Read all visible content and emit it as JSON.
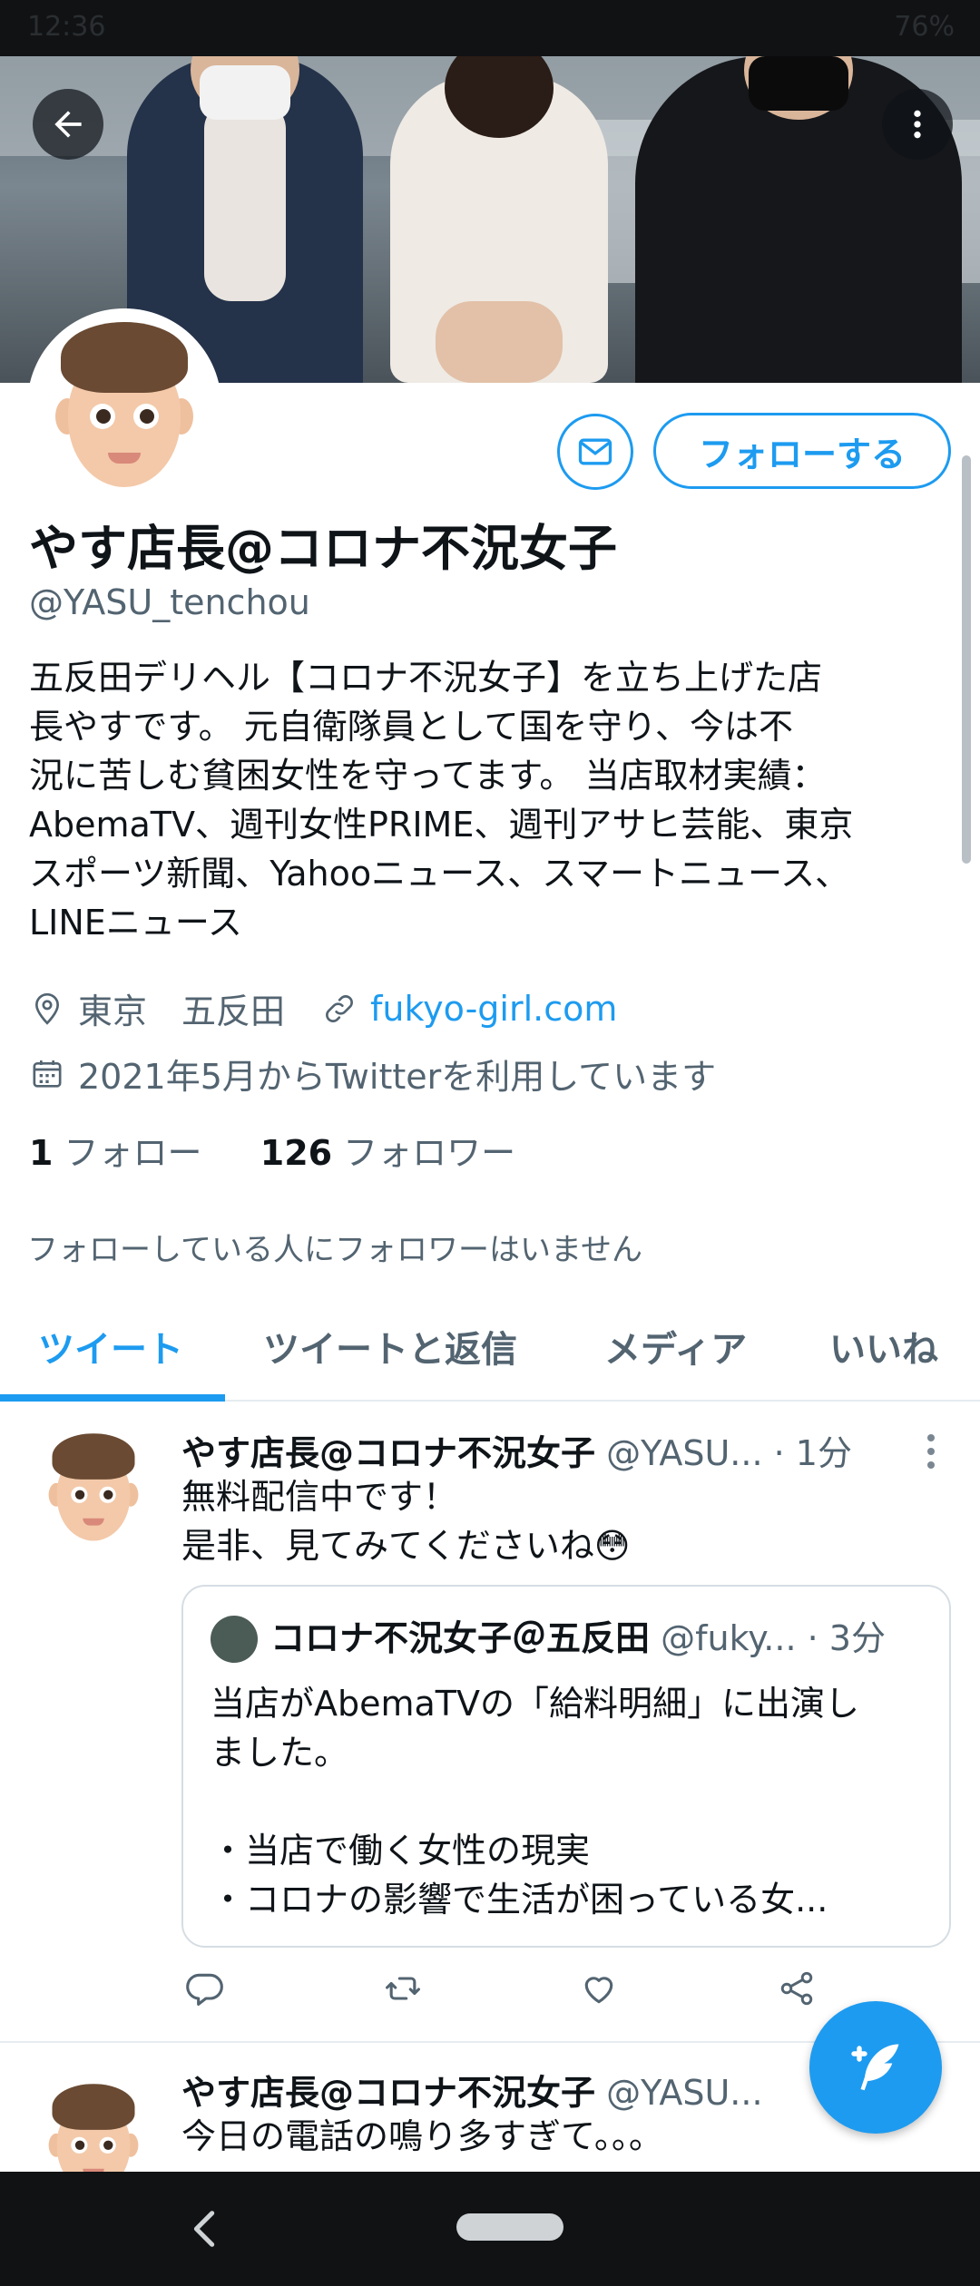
{
  "status_bar": {
    "time": "12:36",
    "right": "76%"
  },
  "profile": {
    "display_name": "やす店長@コロナ不況女子",
    "handle": "@YASU_tenchou",
    "bio_lines": [
      "五反田デリヘル【コロナ不況女子】を立ち上げた店",
      "長やすです。 元自衛隊員として国を守り、今は不",
      "況に苦しむ貧困女性を守ってます。 当店取材実績：",
      "AbemaTV、週刊女性PRIME、週刊アサヒ芸能、東京",
      "スポーツ新聞、Yahooニュース、スマートニュース、",
      "LINEニュース"
    ],
    "location": "東京　五反田",
    "website": "fukyo-girl.com",
    "joined": "2021年5月からTwitterを利用しています",
    "following_count": "1",
    "following_label": "フォロー",
    "followers_count": "126",
    "followers_label": "フォロワー",
    "mutual_note": "フォローしている人にフォロワーはいません"
  },
  "buttons": {
    "follow": "フォローする"
  },
  "tabs": [
    {
      "label": "ツイート",
      "active": true
    },
    {
      "label": "ツイートと返信",
      "active": false
    },
    {
      "label": "メディア",
      "active": false
    },
    {
      "label": "いいね",
      "active": false
    }
  ],
  "tweets": [
    {
      "name": "やす店長@コロナ不況女子",
      "handle": "@YASU...",
      "time": "· 1分",
      "lines": [
        "無料配信中です！",
        "是非、見てみてくださいね😳"
      ],
      "quote": {
        "name": "コロナ不況女子＠五反田",
        "handle": "@fuky...",
        "time": "· 3分",
        "lines": [
          "当店がAbemaTVの「給料明細」に出演し",
          "ました。",
          "",
          "・当店で働く女性の現実",
          "・コロナの影響で生活が困っている女..."
        ]
      }
    },
    {
      "name": "やす店長@コロナ不況女子",
      "handle": "@YASU...",
      "lines": [
        "今日の電話の鳴り多すぎて。。。"
      ]
    }
  ],
  "colors": {
    "accent": "#1d9bf0",
    "text": "#0f1419",
    "muted": "#536471"
  },
  "icons": [
    "back-arrow-icon",
    "more-vertical-icon",
    "mail-icon",
    "location-pin-icon",
    "link-icon",
    "calendar-icon",
    "reply-icon",
    "retweet-icon",
    "like-icon",
    "share-icon",
    "compose-icon"
  ]
}
